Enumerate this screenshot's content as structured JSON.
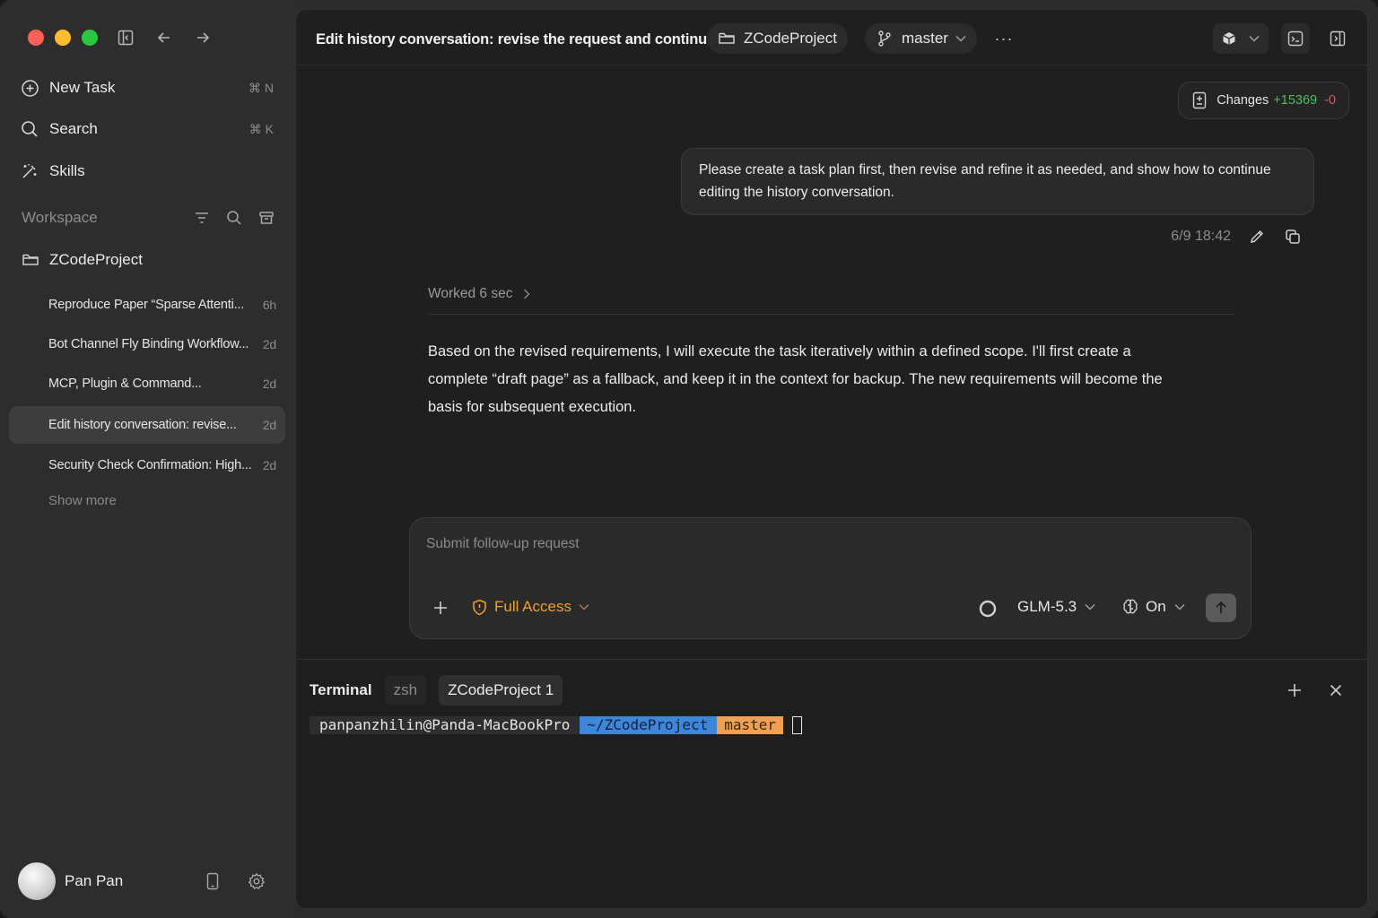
{
  "sidebar": {
    "nav": [
      {
        "label": "New Task",
        "shortcut": "⌘ N",
        "icon": "plus-circle-icon"
      },
      {
        "label": "Search",
        "shortcut": "⌘ K",
        "icon": "search-icon"
      },
      {
        "label": "Skills",
        "shortcut": "",
        "icon": "wand-icon"
      }
    ],
    "workspace_label": "Workspace",
    "project": "ZCodeProject",
    "tasks": [
      {
        "title": "Reproduce Paper “Sparse Attenti...",
        "age": "6h"
      },
      {
        "title": "Bot Channel Fly Binding Workflow...",
        "age": "2d"
      },
      {
        "title": "MCP,  Plugin & Command...",
        "age": "2d"
      },
      {
        "title": "Edit history conversation: revise...",
        "age": "2d"
      },
      {
        "title": "Security Check Confirmation: High...",
        "age": "2d"
      }
    ],
    "show_more": "Show more",
    "user_name": "Pan Pan"
  },
  "header": {
    "title": "Edit history conversation: revise the request and continue",
    "project": "ZCodeProject",
    "branch": "master",
    "more": "···"
  },
  "changes": {
    "label": "Changes",
    "added": "+15369",
    "removed": "-0"
  },
  "conversation": {
    "user_message": "Please create a task plan first, then revise and refine it as needed, and show how to continue editing the history conversation.",
    "timestamp": "6/9 18:42",
    "worked": "Worked 6 sec",
    "assistant_message": "Based on the revised requirements, I will execute the task iteratively within a defined scope. I'll first create a complete “draft page” as a fallback, and keep it in the context for backup. The new requirements will become the basis for subsequent execution."
  },
  "composer": {
    "placeholder": "Submit follow-up request",
    "access": "Full Access",
    "model": "GLM-5.3",
    "thinking": "On"
  },
  "terminal": {
    "label": "Terminal",
    "tabs": [
      "zsh",
      "ZCodeProject 1"
    ],
    "user_host": "panpanzhilin@Panda-MacBookPro",
    "path": "~/ZCodeProject",
    "branch": "master"
  },
  "colors": {
    "accent_orange": "#f0a030",
    "added_green": "#4fbf5b",
    "removed_red": "#e05a5a",
    "path_blue": "#3d86d8"
  }
}
